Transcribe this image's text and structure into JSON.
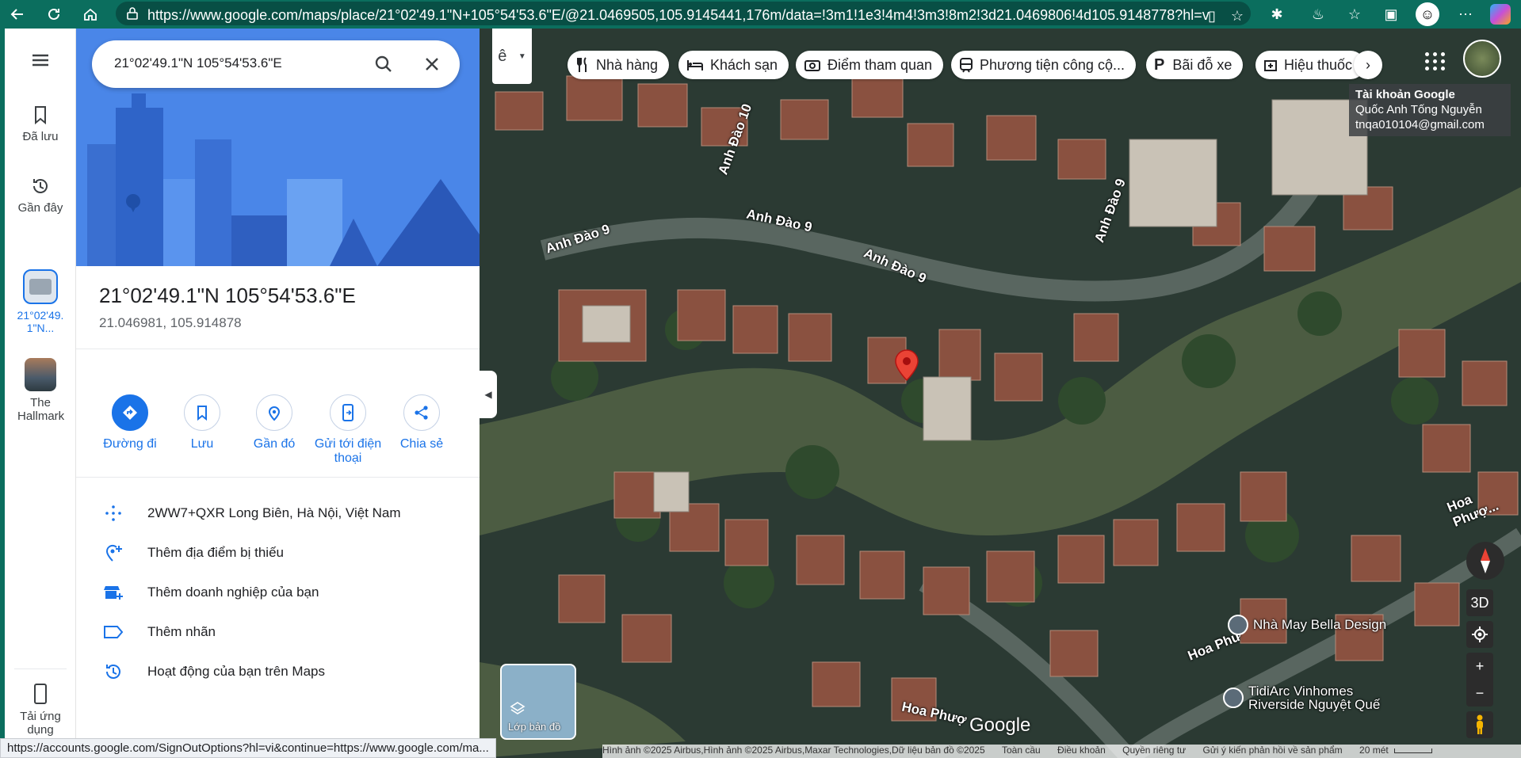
{
  "browser": {
    "url": "https://www.google.com/maps/place/21°02'49.1\"N+105°54'53.6\"E/@21.0469505,105.9145441,176m/data=!3m1!1e3!4m4!3m3!8m2!3d21.0469806!4d105.9148778?hl=vi...",
    "status_url": "https://accounts.google.com/SignOutOptions?hl=vi&continue=https://www.google.com/ma..."
  },
  "rail": {
    "saved": "Đã lưu",
    "recent": "Gần đây",
    "place_label": "21°02'49.1\"N...",
    "hallmark": "The Hallmark",
    "get_app": "Tải ứng dụng"
  },
  "search": {
    "value": "21°02'49.1\"N 105°54'53.6\"E"
  },
  "place": {
    "title": "21°02'49.1\"N 105°54'53.6\"E",
    "coords": "21.046981, 105.914878"
  },
  "actions": {
    "directions": "Đường đi",
    "save": "Lưu",
    "nearby": "Gần đó",
    "send": "Gửi tới điện thoại",
    "share": "Chia sẻ"
  },
  "info": {
    "plus_code": "2WW7+QXR Long Biên, Hà Nội, Việt Nam",
    "add_place": "Thêm địa điểm bị thiếu",
    "add_business": "Thêm doanh nghiệp của bạn",
    "add_label": "Thêm nhãn",
    "activity": "Hoạt động của bạn trên Maps"
  },
  "chips": {
    "restaurants": "Nhà hàng",
    "hotels": "Khách sạn",
    "attractions": "Điểm tham quan",
    "transit": "Phương tiện công cộ...",
    "parking": "Bãi đỗ xe",
    "pharmacy": "Hiệu thuốc"
  },
  "account": {
    "heading": "Tài khoản Google",
    "name": "Quốc Anh Tống Nguyễn",
    "email": "tnqa010104@gmail.com"
  },
  "map": {
    "streets": [
      "Anh Đào 9",
      "Anh Đào 9",
      "Anh Đào 9",
      "Anh Đào 10",
      "Anh Đào 9",
      "Hoa Phượ...",
      "Hoa Phượ",
      "Hoa Phư"
    ],
    "poi1": "Nhà May Bella Design",
    "poi2": "TidiArc Vinhomes Riverside Nguyệt Quế",
    "layers": "Lớp bản đồ",
    "threeD": "3D",
    "logo": "Google",
    "ime": "ê",
    "copyright": "Hình ảnh ©2025 Airbus,Hình ảnh ©2025 Airbus,Maxar Technologies,Dữ liệu bản đồ ©2025",
    "global": "Toàn cầu",
    "terms": "Điều khoản",
    "privacy": "Quyền riêng tư",
    "feedback": "Gửi ý kiến phản hồi về sản phẩm",
    "scale": "20 mét"
  },
  "colors": {
    "accent": "#1a73e8",
    "chrome": "#0b6e5e",
    "pin": "#ea4335"
  }
}
